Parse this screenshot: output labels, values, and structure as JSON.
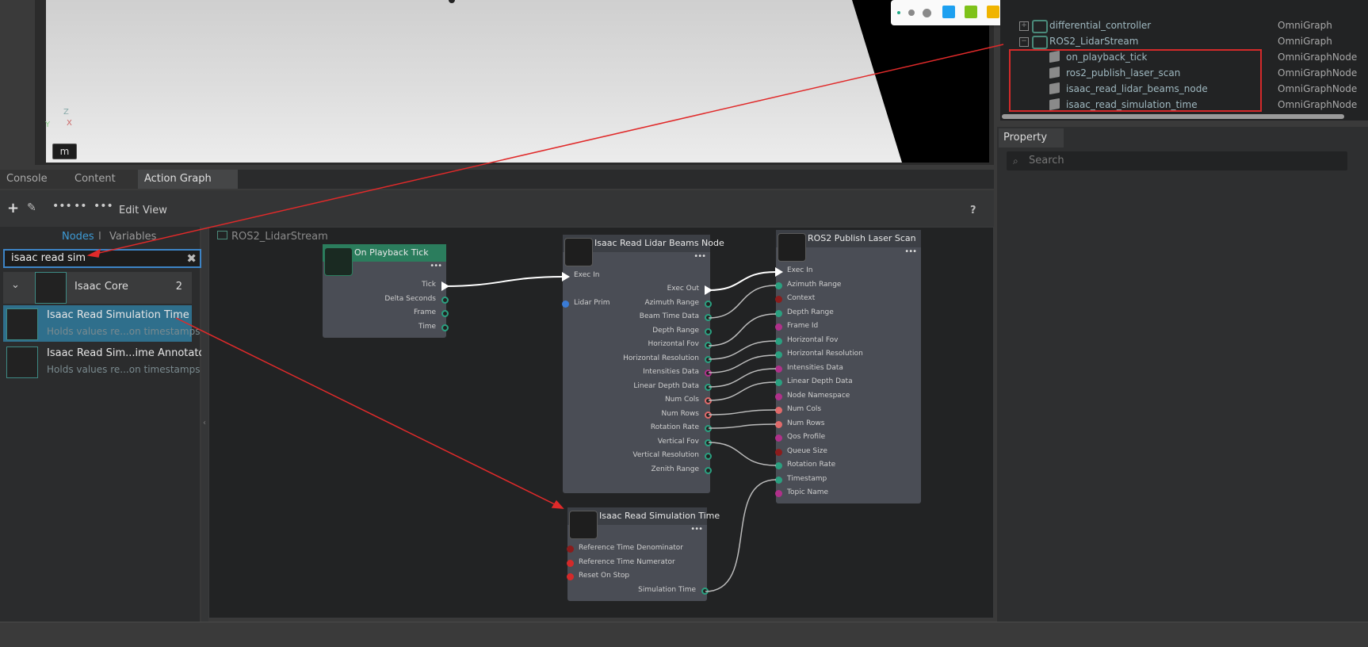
{
  "viewport": {
    "axis_z": "Z",
    "axis_y": "Y",
    "axis_x": "X",
    "mode_button": "m",
    "colors": {
      "floor": "#dcdcdc",
      "wall": "#000000"
    }
  },
  "color_toolbar": {
    "swatches": [
      "#1ea0f0",
      "#7ec21a",
      "#f0b400",
      "#4a4a4a",
      "#ffffff",
      "#f04040"
    ]
  },
  "stage": {
    "rows": [
      {
        "name": "differential_controller",
        "type": "OmniGraph",
        "kind": "graph"
      },
      {
        "name": "ROS2_LidarStream",
        "type": "OmniGraph",
        "kind": "graph"
      },
      {
        "name": "on_playback_tick",
        "type": "OmniGraphNode",
        "kind": "node"
      },
      {
        "name": "ros2_publish_laser_scan",
        "type": "OmniGraphNode",
        "kind": "node"
      },
      {
        "name": "isaac_read_lidar_beams_node",
        "type": "OmniGraphNode",
        "kind": "node"
      },
      {
        "name": "isaac_read_simulation_time",
        "type": "OmniGraphNode",
        "kind": "node"
      }
    ]
  },
  "property": {
    "tab": "Property",
    "search_placeholder": "Search"
  },
  "bottom_tabs": [
    "Console",
    "Content",
    "Action Graph"
  ],
  "toolbar": {
    "edit": "Edit",
    "view": "View",
    "help": "?"
  },
  "node_panel": {
    "tab_nodes": "Nodes",
    "separator": "I",
    "tab_variables": "Variables",
    "search_value": "isaac read sim",
    "category": {
      "name": "Isaac Core",
      "count": "2"
    },
    "results": [
      {
        "title": "Isaac Read Simulation Time",
        "subtitle": "Holds values re...on timestamps"
      },
      {
        "title": "Isaac Read Sim...ime Annotator",
        "subtitle": "Holds values re...on timestamps"
      }
    ]
  },
  "graph": {
    "title": "ROS2_LidarStream",
    "nodes": {
      "playback": {
        "title": "On Playback Tick",
        "outputs": [
          "Tick",
          "Delta Seconds",
          "Frame",
          "Time"
        ]
      },
      "lidar": {
        "title": "Isaac Read Lidar Beams Node",
        "inputs": [
          "Exec In",
          "Lidar Prim"
        ],
        "outputs": [
          "Exec Out",
          "Azimuth Range",
          "Beam Time Data",
          "Depth Range",
          "Horizontal Fov",
          "Horizontal Resolution",
          "Intensities Data",
          "Linear Depth Data",
          "Num Cols",
          "Num Rows",
          "Rotation Rate",
          "Vertical Fov",
          "Vertical Resolution",
          "Zenith Range"
        ]
      },
      "ros2": {
        "title": "ROS2 Publish Laser Scan",
        "inputs": [
          "Exec In",
          "Azimuth Range",
          "Context",
          "Depth Range",
          "Frame Id",
          "Horizontal Fov",
          "Horizontal Resolution",
          "Intensities Data",
          "Linear Depth Data",
          "Node Namespace",
          "Num Cols",
          "Num Rows",
          "Qos Profile",
          "Queue Size",
          "Rotation Rate",
          "Timestamp",
          "Topic Name"
        ]
      },
      "simtime": {
        "title": "Isaac Read Simulation Time",
        "inputs": [
          "Reference Time Denominator",
          "Reference Time Numerator",
          "Reset On Stop"
        ],
        "outputs": [
          "Simulation Time"
        ]
      }
    }
  }
}
